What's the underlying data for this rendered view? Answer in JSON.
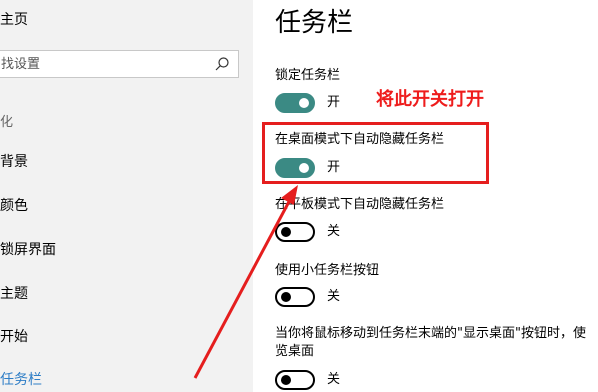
{
  "sidebar": {
    "home": "主页",
    "search_placeholder": "找设置",
    "section": "化",
    "items": [
      {
        "label": "背景"
      },
      {
        "label": "颜色"
      },
      {
        "label": "锁屏界面"
      },
      {
        "label": "主题"
      },
      {
        "label": "开始"
      },
      {
        "label": "任务栏"
      }
    ]
  },
  "main": {
    "title": "任务栏",
    "settings": [
      {
        "label": "锁定任务栏",
        "state": "开",
        "on": true
      },
      {
        "label": "在桌面模式下自动隐藏任务栏",
        "state": "开",
        "on": true
      },
      {
        "label": "在平板模式下自动隐藏任务栏",
        "state": "关",
        "on": false
      },
      {
        "label": "使用小任务栏按钮",
        "state": "关",
        "on": false
      },
      {
        "label_line1": "当你将鼠标移动到任务栏末端的\"显示桌面\"按钮时，使",
        "label_line2": "览桌面",
        "state": "关",
        "on": false
      }
    ]
  },
  "annotation": {
    "callout": "将此开关打开",
    "color": "#ee1c1c"
  },
  "colors": {
    "accent": "#3b8a84",
    "sidebar_bg": "#f2f2f2",
    "active_nav": "#2d7dc6"
  }
}
